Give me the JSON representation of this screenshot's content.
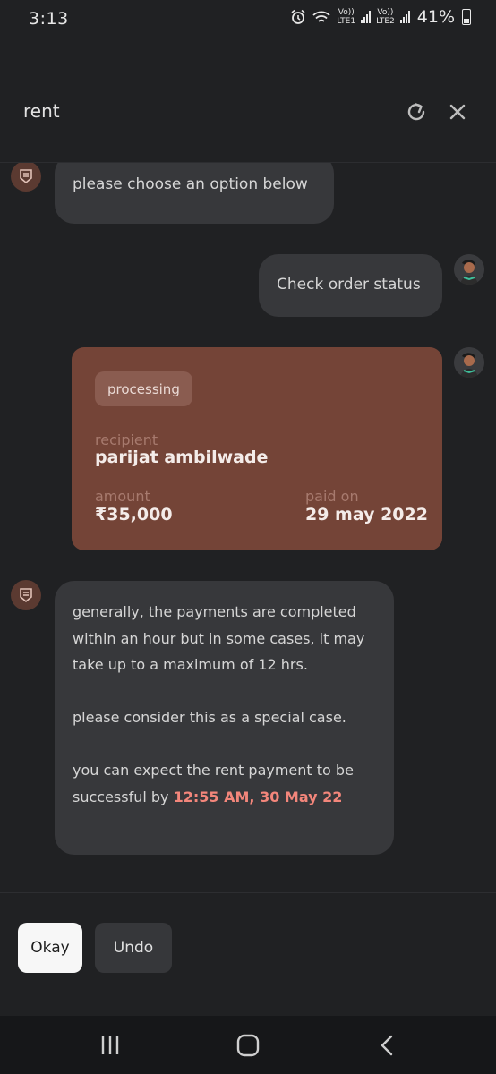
{
  "status_bar": {
    "time": "3:13",
    "sim1_label_top": "Vo))",
    "sim1_label_bottom": "LTE1",
    "sim2_label_top": "Vo))",
    "sim2_label_bottom": "LTE2",
    "battery_percent": "41%"
  },
  "header": {
    "title": "rent",
    "refresh_icon": "refresh-icon",
    "close_icon": "close-icon"
  },
  "messages": {
    "bot_prompt": "please choose an option below",
    "user_choice": "Check order status",
    "order": {
      "status": "processing",
      "recipient_label": "recipient",
      "recipient_value": "parijat ambilwade",
      "amount_label": "amount",
      "amount_value": "₹35,000",
      "paid_on_label": "paid on",
      "paid_on_value": "29 may 2022"
    },
    "bot_info": {
      "line1": "generally, the payments are completed within an hour but in some cases, it may take up to a maximum of 12 hrs.",
      "line2": "please consider this as a special case.",
      "line3_prefix": "you can expect the rent payment to be successful by ",
      "line3_highlight": "12:55 AM, 30 May 22"
    }
  },
  "quick_replies": {
    "okay": "Okay",
    "undo": "Undo"
  },
  "colors": {
    "background": "#202123",
    "bubble": "#37383b",
    "order_card": "#744437",
    "highlight": "#f3867b"
  }
}
